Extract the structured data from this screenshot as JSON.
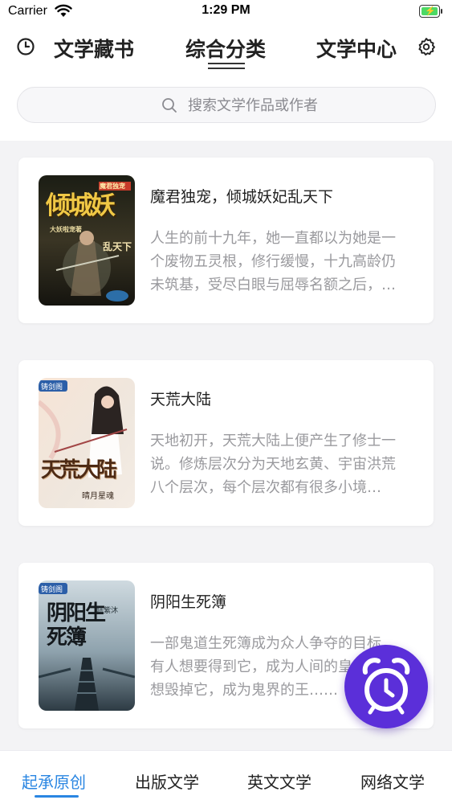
{
  "status_bar": {
    "carrier": "Carrier",
    "time": "1:29 PM"
  },
  "nav": {
    "tabs": [
      {
        "label": "文学藏书"
      },
      {
        "label": "综合分类",
        "active": true
      },
      {
        "label": "文学中心"
      }
    ],
    "left_icon": "clock-icon",
    "right_icon": "gear-icon"
  },
  "search": {
    "placeholder": "搜索文学作品或作者"
  },
  "books": [
    {
      "title": "魔君独宠，倾城妖妃乱天下",
      "description": "人生的前十九年，她一直都以为她是一个废物五灵根，修行缓慢，十九高龄仍未筑基，受尽白眼与屈辱名额之后，她终于明白……",
      "cover": {
        "big_text": "倾城妖",
        "top_text": "魔君独宠",
        "bottom_text": "乱天下",
        "side_text": "大妖啦宠著"
      }
    },
    {
      "title": "天荒大陆",
      "description": "天地初开，天荒大陆上便产生了修士一说。修炼层次分为天地玄黄、宇宙洪荒八个层次，每个层次都有很多小境界……",
      "cover": {
        "badge": "铸剑阁",
        "big_text": "天荒大陆",
        "author_text": "晴月星魂"
      }
    },
    {
      "title": "阴阳生死簿",
      "description": "一部鬼道生死簿成为众人争夺的目标，有人想要得到它，成为人间的皇，有人想毁掉它，成为鬼界的王……",
      "cover": {
        "badge": "铸剑阁",
        "big_text": "阴阳生死簿",
        "author_text": "陆紫沐"
      }
    }
  ],
  "fab": {
    "icon": "alarm-clock-icon",
    "color": "#5b2fd9"
  },
  "bottom_tabs": [
    {
      "label": "起承原创",
      "active": true
    },
    {
      "label": "出版文学"
    },
    {
      "label": "英文文学"
    },
    {
      "label": "网络文学"
    }
  ],
  "colors": {
    "accent": "#2a86e2",
    "fab": "#5b2fd9",
    "description": "#9a9a9e"
  }
}
